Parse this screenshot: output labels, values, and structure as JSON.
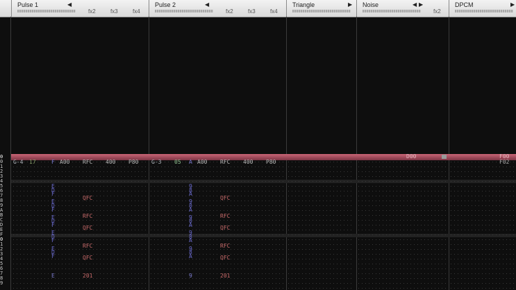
{
  "colors": {
    "note": "#aeb3ba",
    "instrument": "#7a8a5a",
    "volume": "#8fc08f",
    "effect": "#c8c8c8",
    "effect_param": "#8c8c8c",
    "note_off": "#6666cc",
    "effect_col": "#c86a6a"
  },
  "channels": [
    {
      "id": "pulse1",
      "title": "Pulse 1",
      "arrows": [
        "◀"
      ],
      "fx": [
        "fx2",
        "fx3",
        "fx4"
      ]
    },
    {
      "id": "pulse2",
      "title": "Pulse 2",
      "arrows": [
        "◀"
      ],
      "fx": [
        "fx2",
        "fx3",
        "fx4"
      ]
    },
    {
      "id": "triangle",
      "title": "Triangle",
      "arrows": [
        "▶"
      ],
      "fx": []
    },
    {
      "id": "noise",
      "title": "Noise",
      "arrows": [
        "◀",
        "▶"
      ],
      "fx": [
        "fx2"
      ]
    },
    {
      "id": "dpcm",
      "title": "DPCM",
      "arrows": [
        "▶"
      ],
      "fx": []
    }
  ],
  "row_numbers": [
    "0",
    "0",
    "1",
    "2",
    "3",
    "4",
    "5",
    "6",
    "7",
    "8",
    "9",
    "A",
    "B",
    "C",
    "D",
    "E",
    "F",
    "0",
    "1",
    "2",
    "3",
    "4",
    "5",
    "6",
    "7",
    "8",
    "9"
  ],
  "cursor_row": {
    "pulse1": {
      "note": "G-4",
      "inst": "17",
      "vol": "F",
      "fx1": "A00",
      "fx2": "RFC",
      "fx3": "400",
      "fx4": "P80"
    },
    "pulse2": {
      "note": "G-3",
      "inst": "05",
      "vol": "A",
      "fx1": "A00",
      "fx2": "RFC",
      "fx3": "400",
      "fx4": "P80"
    },
    "noise_mark": "D00",
    "dpcm_a": "F00",
    "dpcm_b": "F02"
  },
  "rows": {
    "pulse1_vol": [
      "E",
      "D",
      "F",
      "",
      "E",
      "D",
      "F",
      "",
      "E",
      "D",
      "F",
      "",
      "E",
      "D",
      "F",
      "",
      "E",
      "D",
      "F"
    ],
    "pulse1_fx": [
      "",
      "",
      "QFC",
      "",
      "",
      "RFC",
      "",
      "QFC",
      "",
      "",
      "RFC",
      "",
      "QFC"
    ],
    "pulse2_vol": [
      "9",
      "8",
      "A",
      "",
      "9",
      "8",
      "A",
      "",
      "9",
      "8",
      "A",
      "",
      "9",
      "8",
      "A",
      "",
      "9",
      "8",
      "A"
    ],
    "pulse2_fx": [
      "",
      "",
      "QFC",
      "",
      "",
      "RFC",
      "",
      "QFC",
      "",
      "",
      "RFC",
      "",
      "QFC"
    ],
    "bottom_p1_vol": "E",
    "bottom_p1_fx": "201",
    "bottom_p2_vol": "9",
    "bottom_p2_fx": "201"
  }
}
